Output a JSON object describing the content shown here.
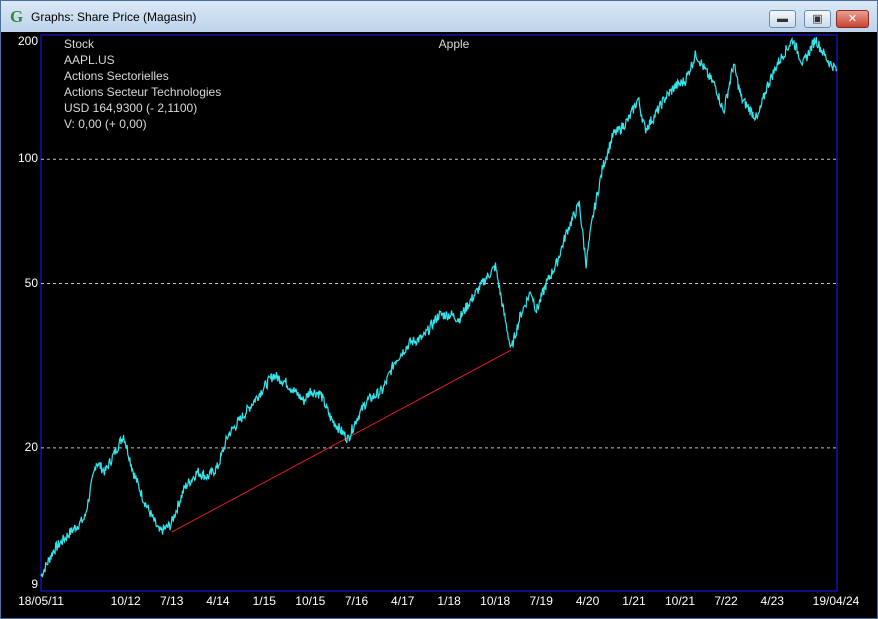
{
  "window": {
    "title": "Graphs: Share Price (Magasin)",
    "app_icon_glyph": "G",
    "minimize_glyph": "▬",
    "maximize_glyph": "▣",
    "close_glyph": "✕"
  },
  "info": {
    "line1": "Stock",
    "line2": "AAPL.US",
    "line3": "Actions Sectorielles",
    "line4": "Actions Secteur Technologies",
    "line5": "USD 164,9300 (- 2,1100)",
    "line6": "V: 0,00 (+ 0,00)"
  },
  "colors": {
    "series": "#33e6ee",
    "trendline": "#e02020",
    "grid": "#bfbfbf",
    "frame": "#1a1aff"
  },
  "chart_data": {
    "type": "line",
    "title": "Apple",
    "y_scale": "log",
    "ylim": [
      9,
      200
    ],
    "y_ticks": [
      9,
      20,
      50,
      100,
      200
    ],
    "grid": "dashed horizontal at 20, 50, 100",
    "x_tick_labels": [
      "18/05/11",
      "10/12",
      "7/13",
      "4/14",
      "1/15",
      "10/15",
      "7/16",
      "4/17",
      "1/18",
      "10/18",
      "7/19",
      "4/20",
      "1/21",
      "10/21",
      "7/22",
      "4/23",
      "19/04/24"
    ],
    "x_ticks": [
      "2011-05-18",
      "2012-10-01",
      "2013-07-01",
      "2014-04-01",
      "2015-01-01",
      "2015-10-01",
      "2016-07-01",
      "2017-04-01",
      "2018-01-01",
      "2018-10-01",
      "2019-07-01",
      "2020-04-01",
      "2021-01-01",
      "2021-10-01",
      "2022-07-01",
      "2023-04-01",
      "2024-04-19"
    ],
    "series": [
      {
        "x": [
          "2011-05-18",
          "2011-08-01",
          "2011-11-01",
          "2012-02-01",
          "2012-04-10",
          "2012-06-01",
          "2012-09-19",
          "2012-11-15",
          "2013-01-15",
          "2013-04-19",
          "2013-06-25",
          "2013-09-15",
          "2013-12-01",
          "2014-02-01",
          "2014-04-01",
          "2014-06-01",
          "2014-09-01",
          "2014-12-01",
          "2015-02-23",
          "2015-05-01",
          "2015-08-24",
          "2015-10-01",
          "2015-12-01",
          "2016-02-01",
          "2016-05-12",
          "2016-07-01",
          "2016-09-01",
          "2016-12-01",
          "2017-02-15",
          "2017-05-15",
          "2017-08-01",
          "2017-11-01",
          "2018-01-15",
          "2018-03-01",
          "2018-05-01",
          "2018-08-01",
          "2018-10-03",
          "2018-11-15",
          "2019-01-03",
          "2019-03-01",
          "2019-05-01",
          "2019-06-03",
          "2019-08-01",
          "2019-10-01",
          "2019-12-01",
          "2020-02-12",
          "2020-03-23",
          "2020-05-01",
          "2020-07-01",
          "2020-09-01",
          "2020-10-01",
          "2020-12-01",
          "2021-01-26",
          "2021-03-08",
          "2021-05-01",
          "2021-07-01",
          "2021-09-01",
          "2021-11-01",
          "2022-01-04",
          "2022-03-15",
          "2022-05-01",
          "2022-06-16",
          "2022-08-15",
          "2022-10-01",
          "2023-01-03",
          "2023-03-01",
          "2023-05-01",
          "2023-07-31",
          "2023-10-01",
          "2023-12-14",
          "2024-01-15",
          "2024-03-01",
          "2024-04-19"
        ],
        "y": [
          9.8,
          11.3,
          12.4,
          13.5,
          18.5,
          17.5,
          21.5,
          17.5,
          15.0,
          12.5,
          13.0,
          16.0,
          17.5,
          17.0,
          18.0,
          21.5,
          24.0,
          27.0,
          30.0,
          29.0,
          26.0,
          27.5,
          27.0,
          23.5,
          21.0,
          23.5,
          26.0,
          27.5,
          32.5,
          36.0,
          37.0,
          42.0,
          42.0,
          41.0,
          45.0,
          51.0,
          55.0,
          44.0,
          34.5,
          42.0,
          48.0,
          43.0,
          50.0,
          56.0,
          67.0,
          78.0,
          56.0,
          72.0,
          96.0,
          115.0,
          117.0,
          125.0,
          140.0,
          118.0,
          127.0,
          140.0,
          150.0,
          155.0,
          180.0,
          160.0,
          150.0,
          130.0,
          170.0,
          140.0,
          125.0,
          150.0,
          170.0,
          195.0,
          170.0,
          196.0,
          185.0,
          172.0,
          165.0
        ]
      }
    ],
    "trendline": {
      "from": [
        "2013-07-01",
        12.5
      ],
      "to": [
        "2019-01-03",
        34.5
      ]
    }
  }
}
